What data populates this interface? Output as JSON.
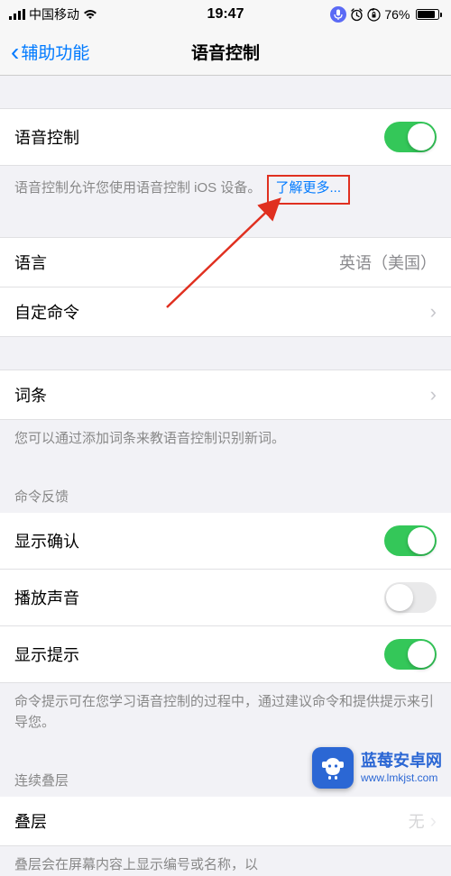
{
  "status": {
    "carrier": "中国移动",
    "time": "19:47",
    "battery_pct": "76%"
  },
  "nav": {
    "back": "辅助功能",
    "title": "语音控制"
  },
  "voice_control": {
    "label": "语音控制",
    "on": true,
    "footer_prefix": "语音控制允许您使用语音控制 iOS 设备。",
    "learn_more": "了解更多..."
  },
  "language": {
    "label": "语言",
    "value": "英语（美国）"
  },
  "custom_commands": {
    "label": "自定命令"
  },
  "vocabulary": {
    "label": "词条",
    "footer": "您可以通过添加词条来教语音控制识别新词。"
  },
  "feedback_header": "命令反馈",
  "show_confirmation": {
    "label": "显示确认",
    "on": true
  },
  "play_sound": {
    "label": "播放声音",
    "on": false
  },
  "show_hints": {
    "label": "显示提示",
    "on": true
  },
  "feedback_footer": "命令提示可在您学习语音控制的过程中，通过建议命令和提供提示来引导您。",
  "overlay_header": "连续叠层",
  "overlay": {
    "label": "叠层",
    "value": "无"
  },
  "overlay_footer_fragment": "叠层会在屏幕内容上显示编号或名称，以",
  "watermark": {
    "title": "蓝莓安卓网",
    "url": "www.lmkjst.com"
  }
}
